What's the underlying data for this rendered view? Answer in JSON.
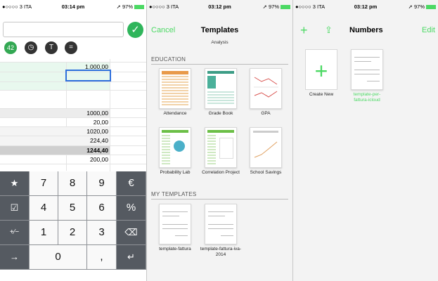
{
  "panel1": {
    "status": {
      "carrier": "●○○○○ 3 ITA",
      "time": "03:14 pm",
      "battery": "97%"
    },
    "toolbar": {
      "count_badge": "42"
    },
    "cells": {
      "top_value": "1.000,00",
      "rows": [
        "1000,00",
        "20,00",
        "1020,00",
        "224,40",
        "1244,40",
        "200,00"
      ]
    },
    "keypad": {
      "row1": [
        "★",
        "7",
        "8",
        "9",
        "€"
      ],
      "row2": [
        "☑",
        "4",
        "5",
        "6",
        "%"
      ],
      "row3": [
        "+∕−",
        "1",
        "2",
        "3",
        "⌫"
      ],
      "row4": [
        "→",
        "0",
        ",",
        "↵"
      ]
    }
  },
  "panel2": {
    "status": {
      "carrier": "●○○○○ 3 ITA",
      "time": "03:12 pm",
      "battery": "97%"
    },
    "nav": {
      "cancel": "Cancel",
      "title": "Templates"
    },
    "prev_label": "Analysis",
    "sections": [
      {
        "title": "EDUCATION"
      },
      {
        "title": "MY TEMPLATES"
      }
    ],
    "education_templates": [
      "Attendance",
      "Grade Book",
      "GPA",
      "Probability Lab",
      "Correlation Project",
      "School Savings"
    ],
    "my_templates": [
      "template-fattura",
      "template-fattura-iva-2014"
    ]
  },
  "panel3": {
    "status": {
      "carrier": "●○○○○ 3 ITA",
      "time": "03:12 pm",
      "battery": "97%"
    },
    "nav": {
      "title": "Numbers",
      "edit": "Edit"
    },
    "create_label": "Create New",
    "docs": [
      "template-per-fattura-icloud"
    ]
  },
  "colors": {
    "accent": "#4cd964",
    "keyboard_dark": "#555a61"
  }
}
